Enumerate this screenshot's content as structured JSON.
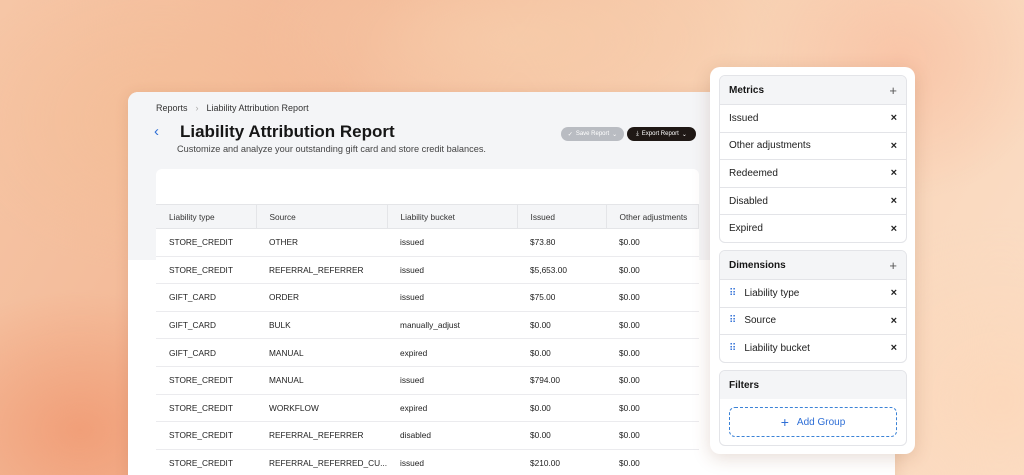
{
  "breadcrumb": {
    "root": "Reports",
    "current": "Liability Attribution Report"
  },
  "page": {
    "title": "Liability Attribution Report",
    "subtitle": "Customize and analyze your outstanding gift card and store credit balances."
  },
  "actions": {
    "save_label": "Save Report",
    "export_label": "Export Report"
  },
  "table": {
    "columns": [
      "Liability type",
      "Source",
      "Liability bucket",
      "Issued",
      "Other adjustments"
    ],
    "rows": [
      [
        "STORE_CREDIT",
        "OTHER",
        "issued",
        "$73.80",
        "$0.00"
      ],
      [
        "STORE_CREDIT",
        "REFERRAL_REFERRER",
        "issued",
        "$5,653.00",
        "$0.00"
      ],
      [
        "GIFT_CARD",
        "ORDER",
        "issued",
        "$75.00",
        "$0.00"
      ],
      [
        "GIFT_CARD",
        "BULK",
        "manually_adjust",
        "$0.00",
        "$0.00"
      ],
      [
        "GIFT_CARD",
        "MANUAL",
        "expired",
        "$0.00",
        "$0.00"
      ],
      [
        "STORE_CREDIT",
        "MANUAL",
        "issued",
        "$794.00",
        "$0.00"
      ],
      [
        "STORE_CREDIT",
        "WORKFLOW",
        "expired",
        "$0.00",
        "$0.00"
      ],
      [
        "STORE_CREDIT",
        "REFERRAL_REFERRER",
        "disabled",
        "$0.00",
        "$0.00"
      ],
      [
        "STORE_CREDIT",
        "REFERRAL_REFERRED_CU...",
        "issued",
        "$210.00",
        "$0.00"
      ]
    ]
  },
  "metrics": {
    "title": "Metrics",
    "items": [
      "Issued",
      "Other adjustments",
      "Redeemed",
      "Disabled",
      "Expired"
    ]
  },
  "dimensions": {
    "title": "Dimensions",
    "items": [
      "Liability type",
      "Source",
      "Liability bucket"
    ]
  },
  "filters": {
    "title": "Filters",
    "add_group_label": "Add Group"
  },
  "icons": {
    "back": "chevron-left-icon",
    "breadcrumb_sep": "chevron-right-icon",
    "save": "check-icon",
    "export": "download-icon",
    "dropdown": "chevron-down-icon",
    "add": "plus-icon",
    "remove": "close-icon",
    "drag": "drag-handle-icon"
  },
  "colors": {
    "accent": "#2f6fd6",
    "export_button": "#1f1815",
    "save_button": "#b9bcc2"
  }
}
